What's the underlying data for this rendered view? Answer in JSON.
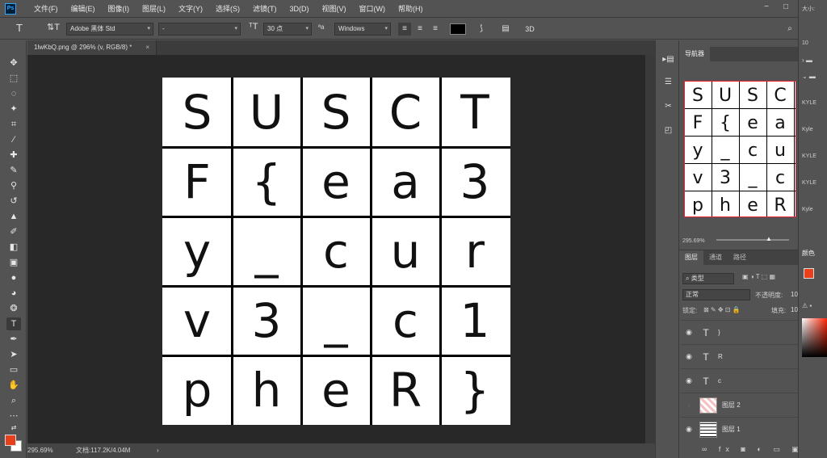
{
  "app": {
    "logo": "Ps"
  },
  "menu": [
    "文件(F)",
    "编辑(E)",
    "图像(I)",
    "图层(L)",
    "文字(Y)",
    "选择(S)",
    "滤镜(T)",
    "3D(D)",
    "视图(V)",
    "窗口(W)",
    "帮助(H)"
  ],
  "window_controls": {
    "minimize": "−",
    "restore": "□",
    "close": "×"
  },
  "options": {
    "font_family": "Adobe 黑体 Std",
    "font_style": "-",
    "font_size": "30 点",
    "antialias": "Windows",
    "aa_label": "ªa",
    "three_d_label": "3D"
  },
  "document": {
    "tab_title": "1lwKbQ.png @ 296% (v, RGB/8) *",
    "tab_close": "×",
    "zoom": "295.69%",
    "doc_info": "文档:117.2K/4.04M"
  },
  "grid_letters": [
    [
      "S",
      "U",
      "S",
      "C",
      "T"
    ],
    [
      "F",
      "{",
      "e",
      "a",
      "3"
    ],
    [
      "y",
      "_",
      "c",
      "u",
      "r"
    ],
    [
      "v",
      "3",
      "_",
      "c",
      "1"
    ],
    [
      "p",
      "h",
      "e",
      "R",
      "}"
    ]
  ],
  "navigator": {
    "tab": "导航器",
    "zoom": "295.69%",
    "thumb_letters": [
      [
        "S",
        "U",
        "S",
        "C"
      ],
      [
        "F",
        "{",
        "e",
        "a"
      ],
      [
        "y",
        "_",
        "c",
        "u"
      ],
      [
        "v",
        "3",
        "_",
        "c"
      ],
      [
        "p",
        "h",
        "e",
        "R"
      ]
    ]
  },
  "layers_panel": {
    "tabs": [
      "图层",
      "通道",
      "路径"
    ],
    "filter_kind": "类型",
    "blend_mode": "正常",
    "opacity_label": "不透明度:",
    "opacity_value": "10",
    "lock_label": "锁定:",
    "fill_label": "填充:",
    "fill_value": "10",
    "layers": [
      {
        "type": "T",
        "name": "}",
        "visible": true
      },
      {
        "type": "T",
        "name": "R",
        "visible": true
      },
      {
        "type": "T",
        "name": "c",
        "visible": true
      },
      {
        "type": "image",
        "name": "图层 2",
        "visible": false
      },
      {
        "type": "image",
        "name": "图层 1",
        "visible": true
      }
    ]
  },
  "right_column": {
    "size_label": "大小:",
    "brush_size": "10",
    "presets": [
      "KYLE",
      "Kyle",
      "KYLE",
      "KYLE",
      "Kyle"
    ],
    "color_tab": "颜色"
  },
  "colors": {
    "foreground": "#e8401c",
    "background": "#ffffff",
    "navigator_frame": "#ee2233"
  }
}
